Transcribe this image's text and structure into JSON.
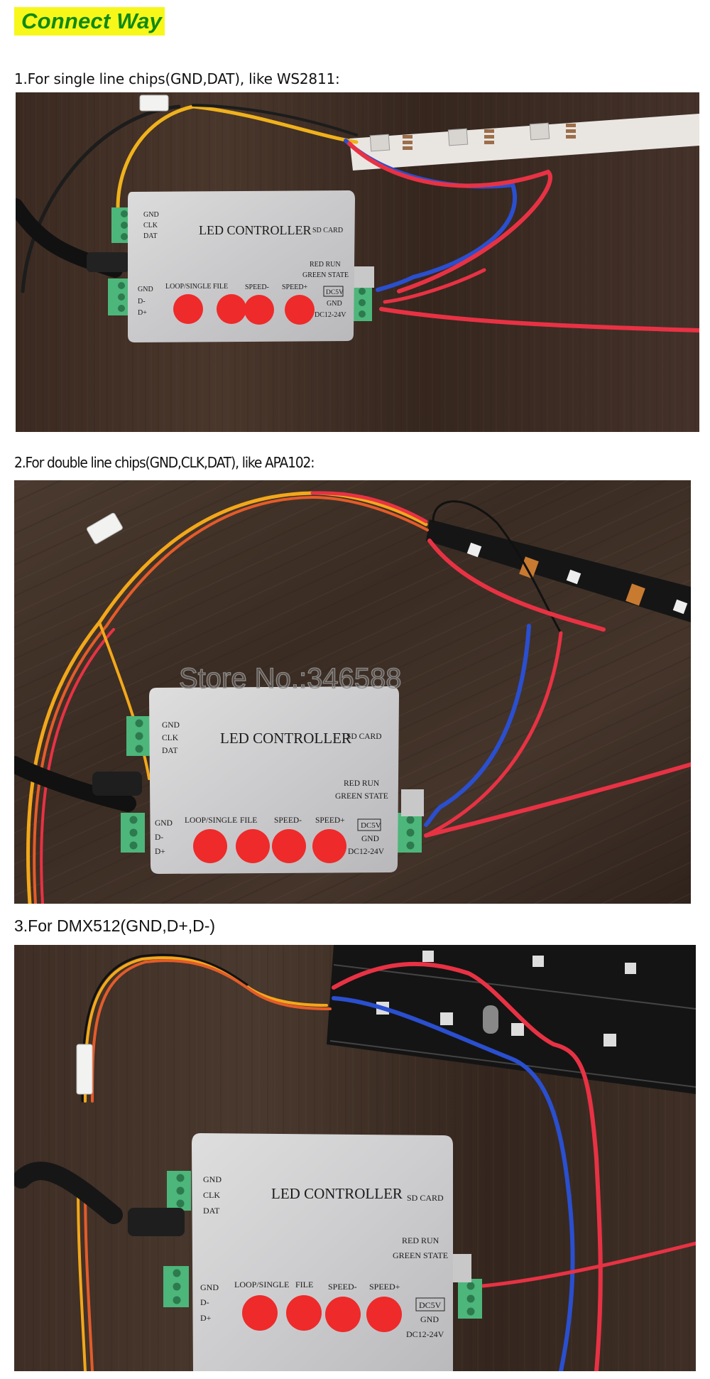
{
  "page": {
    "title": "Connect Way",
    "title_colors": {
      "background": "#f7f71a",
      "text": "#0f8a12"
    }
  },
  "sections": [
    {
      "caption": "1.For single line chips(GND,DAT), like WS2811:",
      "photo_alt": "LED controller wired to a white WS2811 LED strip",
      "strip_color": "white"
    },
    {
      "caption": "2.For double line chips(GND,CLK,DAT), like APA102:",
      "photo_alt": "LED controller wired to a black APA102 LED strip",
      "strip_color": "black",
      "watermark": "Store No.:346588"
    },
    {
      "caption": "3.For DMX512(GND,D+,D-)",
      "photo_alt": "LED controller wired to a black DMX512 pixel board",
      "strip_color": "black-pcb"
    }
  ],
  "controller": {
    "name": "LED CONTROLLER",
    "sd_card": "SD CARD",
    "left_top_terminal": [
      "GND",
      "CLK",
      "DAT"
    ],
    "left_bottom_terminal": [
      "GND",
      "D-",
      "D+"
    ],
    "indicator_lines": [
      "RED RUN",
      "GREEN STATE"
    ],
    "buttons": [
      "LOOP/SINGLE",
      "FILE",
      "SPEED-",
      "SPEED+"
    ],
    "power_labels": [
      "DC5V",
      "GND",
      "DC12-24V"
    ]
  }
}
